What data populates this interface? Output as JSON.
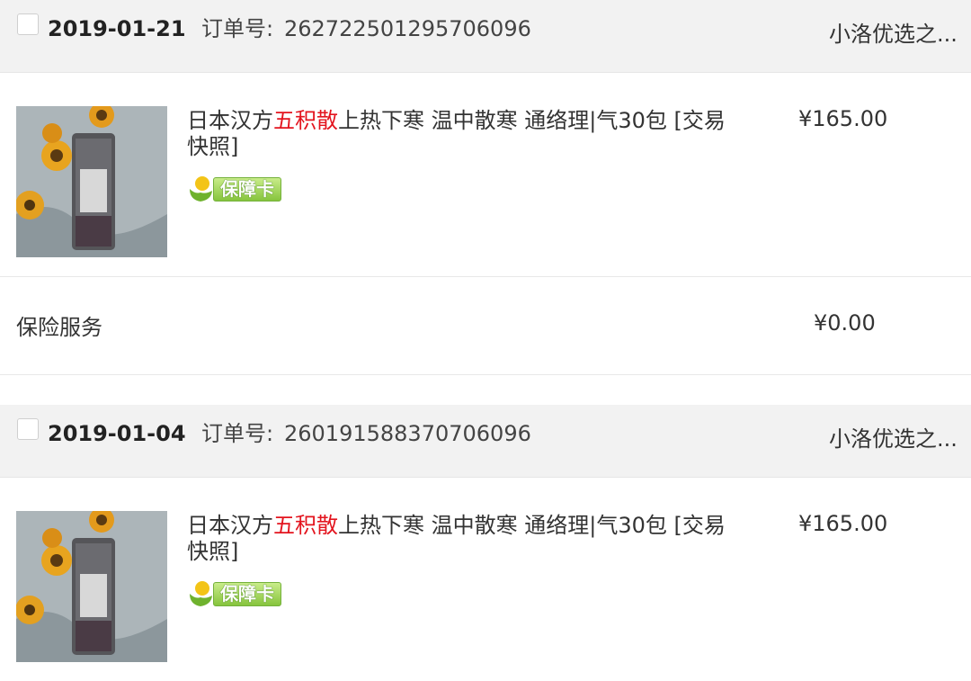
{
  "orders": [
    {
      "date": "2019-01-21",
      "order_no_label": "订单号:",
      "order_no": "262722501295706096",
      "shop_name": "小洛优选之...",
      "item": {
        "title_prefix": "日本汉方",
        "title_highlight": "五积散",
        "title_suffix": "上热下寒 温中散寒 通络理|气30包 [交易快照]",
        "badge_label": "保障卡",
        "price": "¥165.00"
      },
      "service": {
        "label": "保险服务",
        "price": "¥0.00"
      }
    },
    {
      "date": "2019-01-04",
      "order_no_label": "订单号:",
      "order_no": "260191588370706096",
      "shop_name": "小洛优选之...",
      "item": {
        "title_prefix": "日本汉方",
        "title_highlight": "五积散",
        "title_suffix": "上热下寒 温中散寒 通络理|气30包 [交易快照]",
        "badge_label": "保障卡",
        "price": "¥165.00"
      }
    }
  ],
  "colors": {
    "header_bg": "#f2f2f2",
    "highlight": "#e3141e",
    "badge_green": "#86c43d",
    "text": "#333333"
  }
}
